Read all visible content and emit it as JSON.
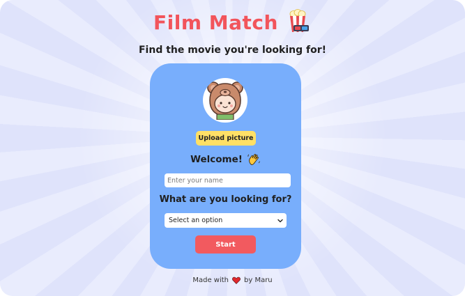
{
  "header": {
    "title": "Film Match",
    "title_icon": "popcorn-3d-glasses-icon",
    "subtitle": "Find the movie you're looking for!"
  },
  "card": {
    "avatar_icon": "bear-hood-avatar",
    "upload_label": "Upload picture",
    "welcome_text": "Welcome!",
    "welcome_icon": "waving-hand-icon",
    "name_placeholder": "Enter your name",
    "question": "What are you looking for?",
    "select_value": "Select an option",
    "start_label": "Start"
  },
  "footer": {
    "made_with": "Made with",
    "heart_icon": "heart-icon",
    "by": "by Maru"
  },
  "colors": {
    "title": "#f2545b",
    "card": "#78aefc",
    "upload_button": "#ffe066",
    "start_button": "#f25a5f",
    "background_rays": "#dfe3fb"
  }
}
